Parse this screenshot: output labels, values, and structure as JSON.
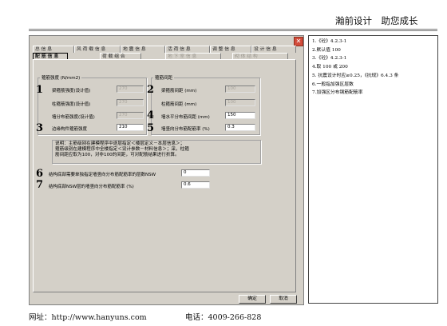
{
  "header": {
    "title": "瀚前设计　助您成长"
  },
  "tabs_row1": [
    {
      "label": "总 信 息"
    },
    {
      "label": "风 荷 载 信 息"
    },
    {
      "label": "地 震 信 息"
    },
    {
      "label": "活 荷 信 息"
    },
    {
      "label": "调 整 信 息"
    },
    {
      "label": "设 计 信 息"
    }
  ],
  "tabs_row2": [
    {
      "label": "配 筋 信 息"
    },
    {
      "label": "荷 载 组 合"
    },
    {
      "label": "地 下 室 信 息"
    },
    {
      "label": "砌 体 结 构"
    }
  ],
  "group_strength": {
    "title": "箍筋强度 (N/mm2)",
    "beam_label": "梁箍筋强度(设计值)",
    "beam_value": "270",
    "col_label": "柱箍筋强度(设计值)",
    "col_value": "270",
    "wall_label": "墙分布筋强度(设计值)",
    "wall_value": "270",
    "edge_label": "边缘构件箍筋强度",
    "edge_value": "210"
  },
  "group_spacing": {
    "title": "箍筋间距",
    "beam_label": "梁箍筋间距 (mm)",
    "beam_value": "100",
    "col_label": "柱箍筋间距 (mm)",
    "col_value": "100",
    "wall_label": "墙水平分布筋间距 (mm)",
    "wall_value": "150",
    "ratio_label": "墙竖向分布筋配筋率 (%)",
    "ratio_value": "0.3"
  },
  "markers": [
    "1",
    "2",
    "3",
    "4",
    "5",
    "6",
    "7"
  ],
  "note": {
    "line1": "说明：主筋级别在建模程序中逐层指定＜楼层定义－本层信息＞；",
    "line2": "箍筋级别在建模程序中全楼指定＜设计参数－材料信息＞；采，柱箍",
    "line3": "筋间距应取为100，对非100的间距，可对配筋结果进行折算。"
  },
  "special_layers": {
    "label": "结构底部需要单独指定墙竖向分布筋配筋率的层数NSW",
    "value": "0"
  },
  "special_ratio": {
    "label": "结构底部NSW层的墙竖向分布筋配筋率 (%)",
    "value": "0.6"
  },
  "buttons": {
    "ok": "确定",
    "cancel": "取消"
  },
  "notes_panel": [
    "1.《砼》4.2.3-1",
    "2.默认值 100",
    "3.《砼》4.2.3-1",
    "4.取 100 或 200",
    "5. 抗震设计时应≥0.25，《抗规》6.4.3 条",
    "6.一般指加强区层数",
    "7.加强区分布钢筋配筋率"
  ],
  "footer": {
    "website": "网址：http://www.hanyuns.com",
    "phone": "电话：4009-266-828"
  },
  "colors": {
    "dialog_bg": "#d4d0c8",
    "close_button": "#d24b3a"
  }
}
